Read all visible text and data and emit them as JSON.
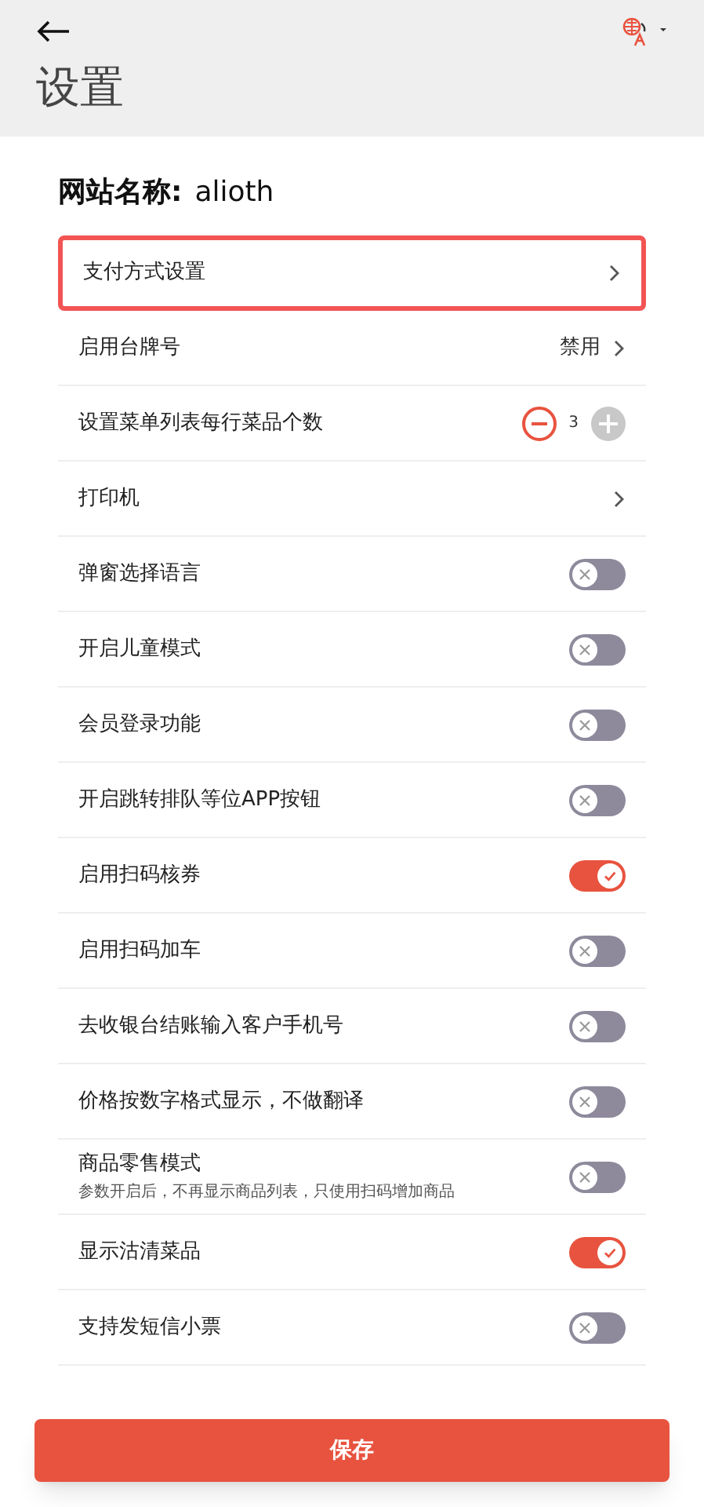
{
  "header": {
    "title": "设置"
  },
  "site_name": {
    "label": "网站名称:",
    "value": "alioth"
  },
  "rows": [
    {
      "kind": "link",
      "label": "支付方式设置",
      "highlighted": true
    },
    {
      "kind": "link",
      "label": "启用台牌号",
      "value": "禁用",
      "highlighted": false
    },
    {
      "kind": "stepper",
      "label": "设置菜单列表每行菜品个数",
      "value": "3",
      "highlighted": false
    },
    {
      "kind": "link",
      "label": "打印机",
      "highlighted": false
    },
    {
      "kind": "toggle",
      "label": "弹窗选择语言",
      "on": false
    },
    {
      "kind": "toggle",
      "label": "开启儿童模式",
      "on": false
    },
    {
      "kind": "toggle",
      "label": "会员登录功能",
      "on": false
    },
    {
      "kind": "toggle",
      "label": "开启跳转排队等位APP按钮",
      "on": false
    },
    {
      "kind": "toggle",
      "label": "启用扫码核券",
      "on": true
    },
    {
      "kind": "toggle",
      "label": "启用扫码加车",
      "on": false
    },
    {
      "kind": "toggle",
      "label": "去收银台结账输入客户手机号",
      "on": false
    },
    {
      "kind": "toggle",
      "label": "价格按数字格式显示，不做翻译",
      "on": false
    },
    {
      "kind": "toggle",
      "label": "商品零售模式",
      "description": "参数开启后，不再显示商品列表，只使用扫码增加商品",
      "on": false
    },
    {
      "kind": "toggle",
      "label": "显示沽清菜品",
      "on": true
    },
    {
      "kind": "toggle",
      "label": "支持发短信小票",
      "on": false
    }
  ],
  "save_button": "保存"
}
